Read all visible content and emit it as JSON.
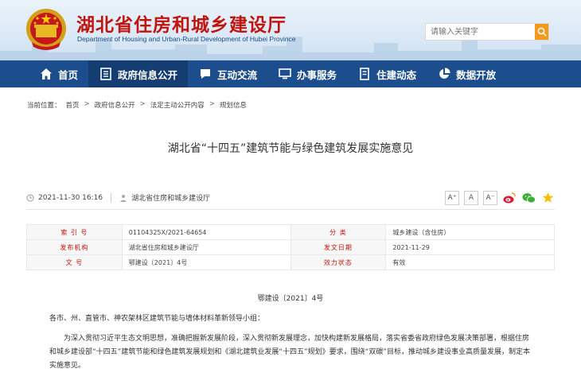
{
  "header": {
    "title": "湖北省住房和城乡建设厅",
    "subtitle": "Department of Housing and Urban-Rural Development of Hubei Province",
    "search_placeholder": "请输入关键字"
  },
  "nav": [
    {
      "label": "首页",
      "icon": "home-icon"
    },
    {
      "label": "政府信息公开",
      "icon": "document-list-icon"
    },
    {
      "label": "互动交流",
      "icon": "chat-icon"
    },
    {
      "label": "办事服务",
      "icon": "monitor-icon"
    },
    {
      "label": "住建动态",
      "icon": "news-icon"
    },
    {
      "label": "数据开放",
      "icon": "pie-chart-icon"
    }
  ],
  "breadcrumb": {
    "prefix": "当前位置：",
    "items": [
      "首页",
      "政府信息公开",
      "法定主动公开内容",
      "规划信息"
    ],
    "separator": ">"
  },
  "article": {
    "title": "湖北省“十四五”建筑节能与绿色建筑发展实施意见",
    "date": "2021-11-30 16:16",
    "source": "湖北省住房和城乡建设厅",
    "font_buttons": [
      "A⁺",
      "A",
      "A⁻"
    ]
  },
  "info": [
    {
      "k1": "索 引 号",
      "v1": "01104325X/2021-64654",
      "k2": "分 类",
      "v2": "城乡建设（含住房）"
    },
    {
      "k1": "发布机构",
      "v1": "湖北省住房和城乡建设厅",
      "k2": "发文日期",
      "v2": "2021-11-29"
    },
    {
      "k1": "文 号",
      "v1": "鄂建设〔2021〕4号",
      "k2": "效力状态",
      "v2": "有效"
    }
  ],
  "content": {
    "docnum": "鄂建设〔2021〕4号",
    "salutation": "各市、州、直管市、神农架林区建筑节能与墙体材料革新领导小组：",
    "paragraph": "为深入贯彻习近平生态文明思想，准确把握新发展阶段，深入贯彻新发展理念，加快构建新发展格局，落实省委省政府绿色发展决策部署，根据住房和城乡建设部“十四五”建筑节能和绿色建筑发展规划和《湖北建筑业发展“十四五”规划》要求，围绕“双碳”目标，推动城乡建设事业高质量发展，制定本实施意见。"
  },
  "colors": {
    "brand_red": "#c0140f",
    "nav_blue": "#1c4d8c",
    "search_orange": "#f39a1c"
  }
}
